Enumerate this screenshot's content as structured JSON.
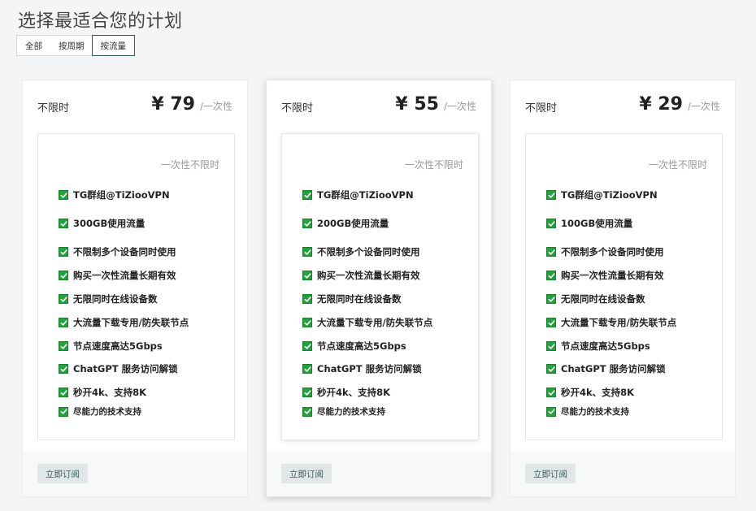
{
  "page": {
    "title": "选择最适合您的计划"
  },
  "filters": [
    {
      "label": "全部",
      "active": false
    },
    {
      "label": "按周期",
      "active": false
    },
    {
      "label": "按流量",
      "active": true
    }
  ],
  "plans": [
    {
      "name": "不限时",
      "price": "¥ 79",
      "period": "/一次性",
      "subtitle": "一次性不限时",
      "features": [
        "TG群组@TiZiooVPN",
        "300GB使用流量",
        "不限制多个设备同时使用",
        "购买一次性流量长期有效",
        "无限同时在线设备数",
        "大流量下载专用/防失联节点",
        "节点速度高达5Gbps",
        "ChatGPT 服务访问解锁",
        "秒开4k、支持8K",
        "尽能力的技术支持"
      ],
      "button": "立即订阅"
    },
    {
      "name": "不限时",
      "price": "¥ 55",
      "period": "/一次性",
      "subtitle": "一次性不限时",
      "features": [
        "TG群组@TiZiooVPN",
        "200GB使用流量",
        "不限制多个设备同时使用",
        "购买一次性流量长期有效",
        "无限同时在线设备数",
        "大流量下载专用/防失联节点",
        "节点速度高达5Gbps",
        "ChatGPT 服务访问解锁",
        "秒开4k、支持8K",
        "尽能力的技术支持"
      ],
      "button": "立即订阅"
    },
    {
      "name": "不限时",
      "price": "¥ 29",
      "period": "/一次性",
      "subtitle": "一次性不限时",
      "features": [
        "TG群组@TiZiooVPN",
        "100GB使用流量",
        "不限制多个设备同时使用",
        "购买一次性流量长期有效",
        "无限同时在线设备数",
        "大流量下载专用/防失联节点",
        "节点速度高达5Gbps",
        "ChatGPT 服务访问解锁",
        "秒开4k、支持8K",
        "尽能力的技术支持"
      ],
      "button": "立即订阅"
    }
  ],
  "colors": {
    "accent": "#2f5d57",
    "check": "#20a33a",
    "button_bg": "#e1e7e7"
  }
}
